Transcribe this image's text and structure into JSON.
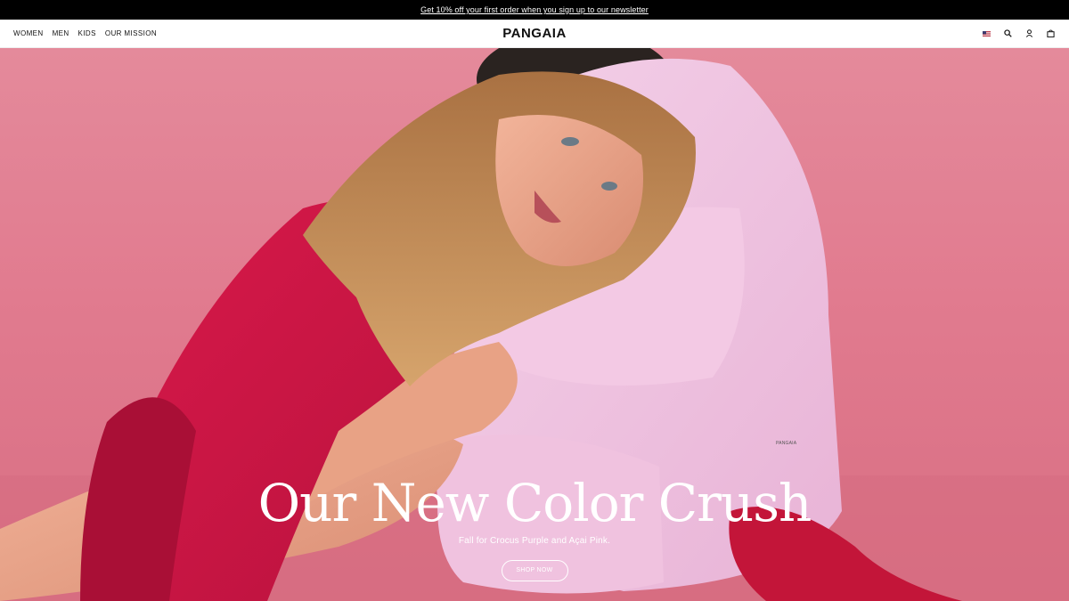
{
  "announcement": {
    "text": "Get 10% off your first order when you sign up to our newsletter"
  },
  "header": {
    "nav": [
      {
        "label": "WOMEN"
      },
      {
        "label": "MEN"
      },
      {
        "label": "KIDS"
      },
      {
        "label": "OUR MISSION"
      }
    ],
    "logo": "PANGAIA",
    "icons": [
      "us-flag-icon",
      "search-icon",
      "account-icon",
      "bag-icon"
    ]
  },
  "hero": {
    "title": "Our New Color Crush",
    "subtitle": "Fall for Crocus Purple and Açai Pink.",
    "cta": "SHOP NOW",
    "garment_tag": "PANGAIA",
    "background_color": "#e48a9b",
    "image_name": "couple-in-pink-and-purple-hero-photo"
  }
}
